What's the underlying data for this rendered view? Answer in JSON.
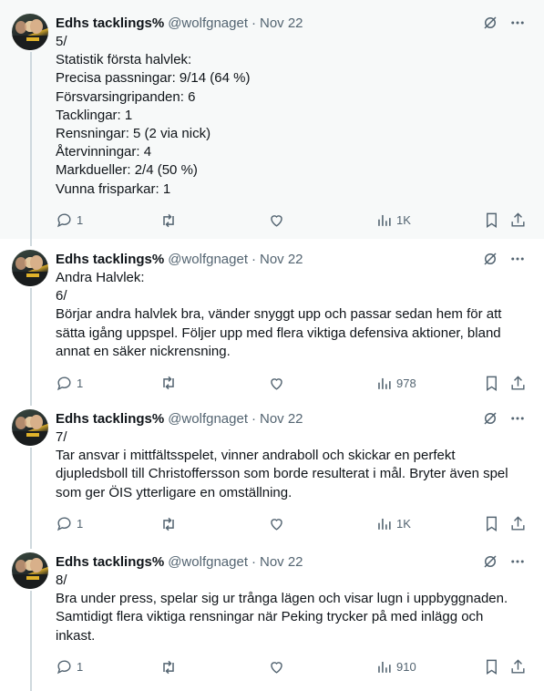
{
  "posts": [
    {
      "author": {
        "display_name": "Edhs tacklings%",
        "handle": "@wolfgnaget",
        "date": "Nov 22"
      },
      "lines": [
        "5/",
        "Statistik första halvlek:",
        "Precisa passningar: 9/14 (64 %)",
        "Försvarsingripanden: 6",
        "Tacklingar: 1",
        "Rensningar: 5 (2 via nick)",
        "Återvinningar: 4",
        "Markdueller: 2/4 (50 %)",
        "Vunna frisparkar: 1"
      ],
      "stats": {
        "replies": "1",
        "views": "1K"
      }
    },
    {
      "author": {
        "display_name": "Edhs tacklings%",
        "handle": "@wolfgnaget",
        "date": "Nov 22"
      },
      "lines": [
        "Andra Halvlek:",
        "6/",
        "Börjar andra halvlek bra, vänder snyggt upp och passar sedan hem för att",
        "sätta igång uppspel. Följer upp med flera viktiga defensiva aktioner, bland",
        "annat en säker nickrensning."
      ],
      "stats": {
        "replies": "1",
        "views": "978"
      }
    },
    {
      "author": {
        "display_name": "Edhs tacklings%",
        "handle": "@wolfgnaget",
        "date": "Nov 22"
      },
      "lines": [
        "7/",
        "Tar ansvar i mittfältsspelet, vinner andraboll och skickar en perfekt",
        "djupledsboll till Christoffersson som borde resulterat i mål. Bryter även spel",
        "som ger ÖIS ytterligare en omställning."
      ],
      "stats": {
        "replies": "1",
        "views": "1K"
      }
    },
    {
      "author": {
        "display_name": "Edhs tacklings%",
        "handle": "@wolfgnaget",
        "date": "Nov 22"
      },
      "lines": [
        "8/",
        "Bra under press, spelar sig ur trånga lägen och visar lugn i uppbyggnaden.",
        "Samtidigt flera viktiga rensningar när Peking trycker på med inlägg och",
        "inkast."
      ],
      "stats": {
        "replies": "1",
        "views": "910"
      }
    }
  ],
  "colors": {
    "text": "#0f1419",
    "secondary": "#536471",
    "thread_line": "#cfd9de",
    "highlight_bg": "#f7f9f9"
  },
  "icons": [
    "grok-icon",
    "more-icon",
    "reply-icon",
    "retweet-icon",
    "like-icon",
    "views-icon",
    "bookmark-icon",
    "share-icon"
  ]
}
